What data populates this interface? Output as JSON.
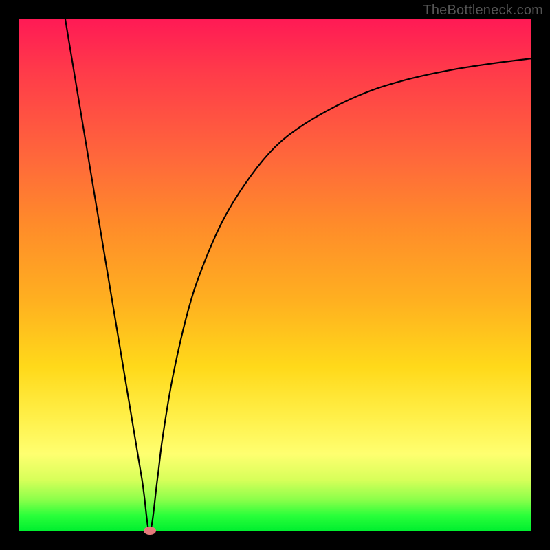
{
  "watermark": "TheBottleneck.com",
  "chart_data": {
    "type": "line",
    "title": "",
    "xlabel": "",
    "ylabel": "",
    "xlim": [
      0,
      100
    ],
    "ylim": [
      0,
      100
    ],
    "grid": false,
    "legend": false,
    "background_gradient": {
      "stops": [
        {
          "pos": 0.0,
          "color": "#ff1a55"
        },
        {
          "pos": 0.28,
          "color": "#ff6a3a"
        },
        {
          "pos": 0.55,
          "color": "#ffb020"
        },
        {
          "pos": 0.78,
          "color": "#fff04a"
        },
        {
          "pos": 0.94,
          "color": "#8aff4a"
        },
        {
          "pos": 1.0,
          "color": "#00ef2f"
        }
      ]
    },
    "series": [
      {
        "name": "bottleneck-curve",
        "color": "#000000",
        "x": [
          9,
          12,
          15,
          18,
          21,
          24,
          25.5,
          27,
          28,
          30,
          33,
          36,
          40,
          45,
          50,
          55,
          60,
          65,
          70,
          75,
          80,
          85,
          90,
          95,
          100
        ],
        "y": [
          100,
          82,
          64,
          46,
          28,
          10,
          0,
          10,
          18,
          30,
          43,
          52,
          61,
          69,
          75,
          79,
          82,
          84.5,
          86.5,
          88,
          89.2,
          90.2,
          91,
          91.7,
          92.3
        ]
      }
    ],
    "marker": {
      "name": "optimum-point",
      "x": 25.5,
      "y": 0,
      "color": "#e47a7a"
    }
  }
}
